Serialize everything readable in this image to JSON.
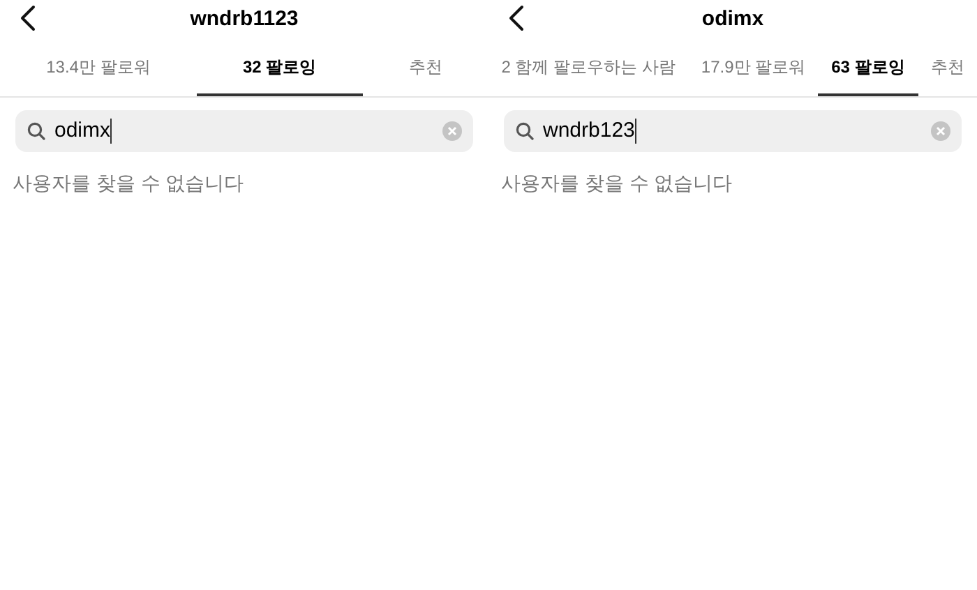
{
  "panels": [
    {
      "title": "wndrb1123",
      "tabs": [
        {
          "label": "13.4만 팔로워",
          "selected": false
        },
        {
          "label": "32 팔로잉",
          "selected": true
        },
        {
          "label": "추천",
          "selected": false
        }
      ],
      "search": {
        "value": "odimx"
      },
      "message": "사용자를 찾을 수 없습니다"
    },
    {
      "title": "odimx",
      "tabs": [
        {
          "label": "2 함께 팔로우하는 사람",
          "selected": false
        },
        {
          "label": "17.9만 팔로워",
          "selected": false
        },
        {
          "label": "63 팔로잉",
          "selected": true
        },
        {
          "label": "추천",
          "selected": false
        }
      ],
      "search": {
        "value": "wndrb123"
      },
      "message": "사용자를 찾을 수 없습니다"
    }
  ]
}
